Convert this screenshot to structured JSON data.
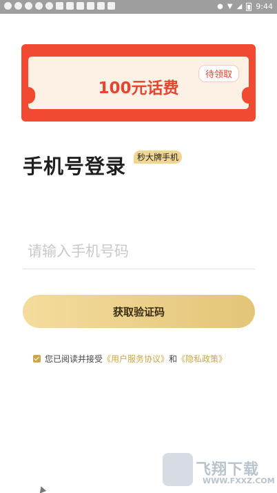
{
  "statusbar": {
    "left_icons": [
      "notification-icon",
      "notification-icon",
      "notification-icon",
      "notification-icon",
      "notification-icon",
      "app-icon",
      "app-icon",
      "app-icon",
      "app-icon",
      "app-icon",
      "app-icon"
    ],
    "time": "9:44"
  },
  "coupon": {
    "amount": "100元话费",
    "badge": "待领取"
  },
  "login": {
    "title": "手机号登录",
    "tag": "秒大牌手机"
  },
  "phone_input": {
    "placeholder": "请输入手机号码",
    "value": ""
  },
  "actions": {
    "get_code": "获取验证码"
  },
  "agreement": {
    "checked": true,
    "prefix": "您已阅读并接受",
    "user_agreement": "《用户服务协议》",
    "and": "和",
    "privacy_policy": "《隐私政策》"
  },
  "watermark": {
    "text": "飞翔下载",
    "url": "WWW.FXXZ.COM"
  }
}
